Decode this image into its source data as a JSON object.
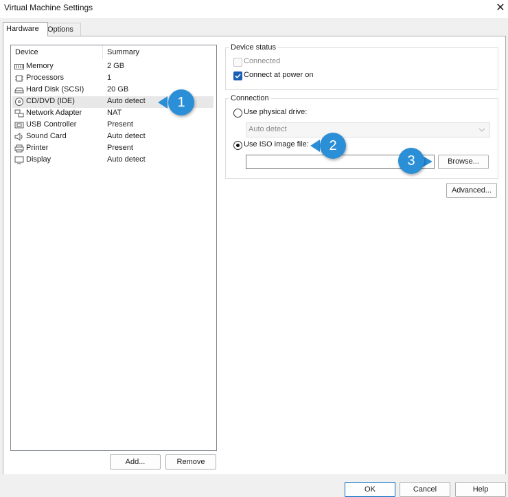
{
  "window": {
    "title": "Virtual Machine Settings",
    "close_glyph": "✕"
  },
  "tabs": [
    {
      "label": "Hardware",
      "active": true
    },
    {
      "label": "Options",
      "active": false
    }
  ],
  "device_list": {
    "columns": [
      "Device",
      "Summary"
    ],
    "rows": [
      {
        "device": "Memory",
        "summary": "2 GB",
        "icon": "memory-icon"
      },
      {
        "device": "Processors",
        "summary": "1",
        "icon": "processor-icon"
      },
      {
        "device": "Hard Disk (SCSI)",
        "summary": "20 GB",
        "icon": "hard-disk-icon"
      },
      {
        "device": "CD/DVD (IDE)",
        "summary": "Auto detect",
        "icon": "cd-dvd-icon",
        "selected": true
      },
      {
        "device": "Network Adapter",
        "summary": "NAT",
        "icon": "network-adapter-icon"
      },
      {
        "device": "USB Controller",
        "summary": "Present",
        "icon": "usb-icon"
      },
      {
        "device": "Sound Card",
        "summary": "Auto detect",
        "icon": "sound-card-icon"
      },
      {
        "device": "Printer",
        "summary": "Present",
        "icon": "printer-icon"
      },
      {
        "device": "Display",
        "summary": "Auto detect",
        "icon": "display-icon"
      }
    ]
  },
  "list_buttons": {
    "add": "Add...",
    "remove": "Remove"
  },
  "device_status": {
    "title": "Device status",
    "connected": {
      "label": "Connected",
      "checked": false,
      "disabled": true
    },
    "connect_at_power_on": {
      "label": "Connect at power on",
      "checked": true
    }
  },
  "connection": {
    "title": "Connection",
    "physical_drive": {
      "label": "Use physical drive:",
      "selected": false
    },
    "physical_drive_value": "Auto detect",
    "iso_image": {
      "label": "Use ISO image file:",
      "selected": true
    },
    "iso_path": "",
    "browse": "Browse...",
    "advanced": "Advanced..."
  },
  "callouts": [
    "1",
    "2",
    "3"
  ],
  "footer_buttons": {
    "ok": "OK",
    "cancel": "Cancel",
    "help": "Help"
  },
  "colors": {
    "accent": "#1a5fb4",
    "callout": "#2b8fd8"
  }
}
